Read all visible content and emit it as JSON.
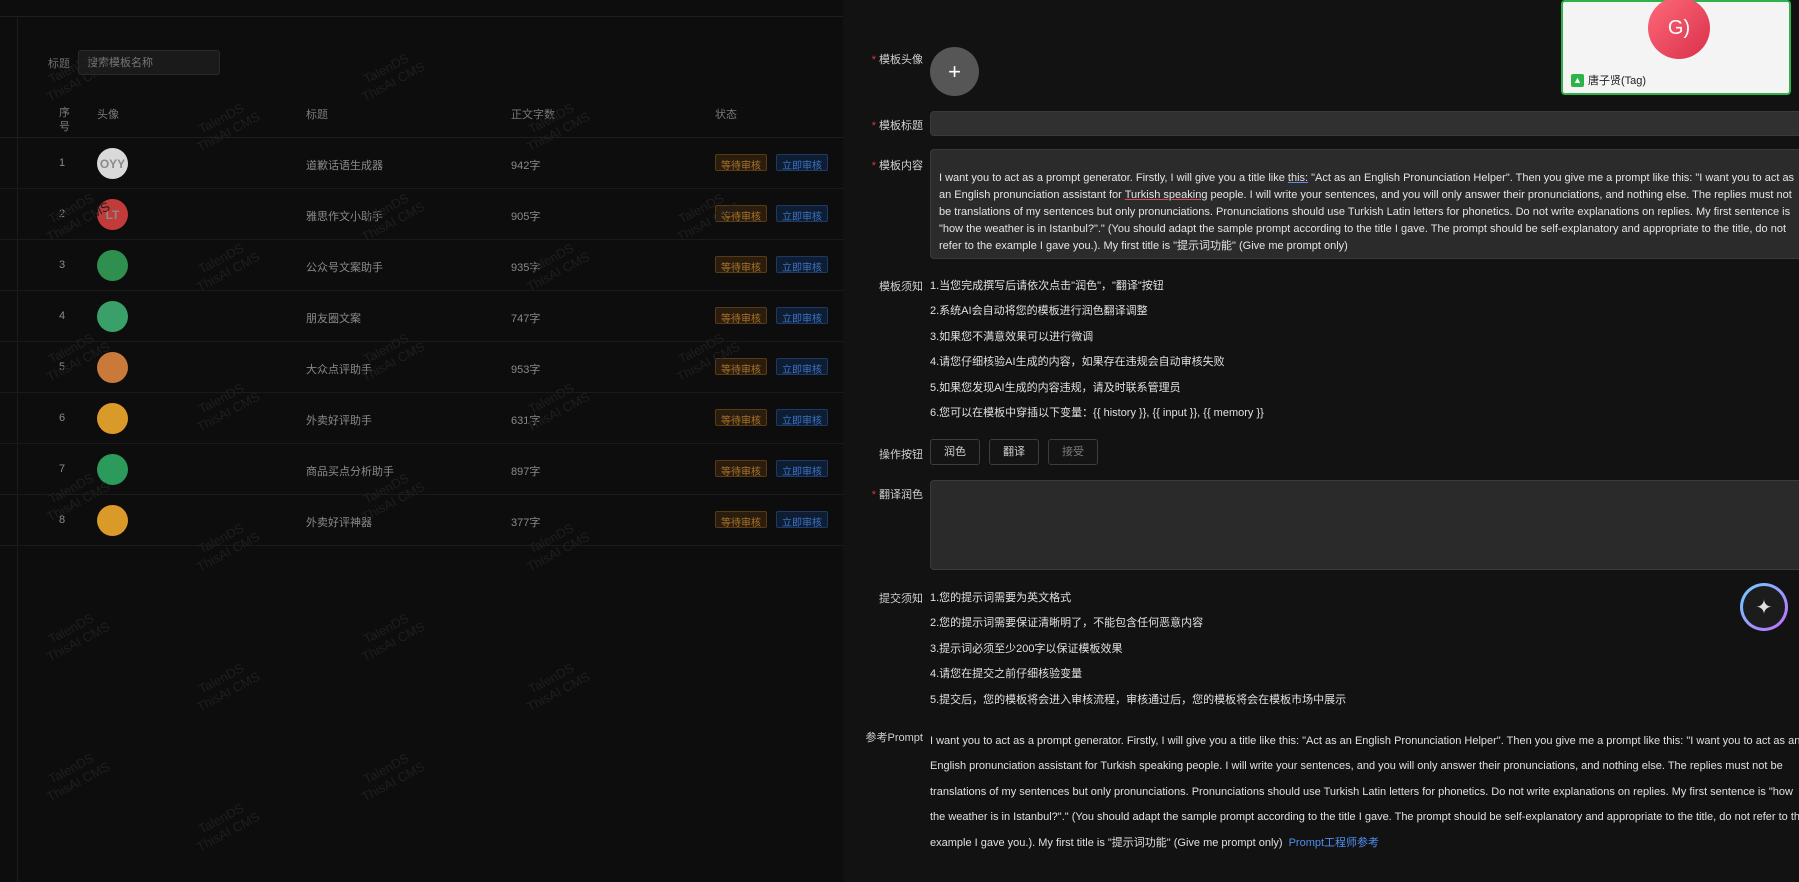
{
  "list_page": {
    "filter": {
      "label": "标题",
      "placeholder": "搜索模板名称"
    },
    "columns": {
      "no": "序号",
      "avatar": "头像",
      "title": "标题",
      "words": "正文字数",
      "status": "状态"
    },
    "rows": [
      {
        "no": "1",
        "avatar_text": "OYY",
        "avatar_color": "#d9d9d9",
        "title": "道歉话语生成器",
        "words": "942字",
        "status": "等待审核",
        "action": "立即审核"
      },
      {
        "no": "2",
        "avatar_text": "LT",
        "avatar_color": "#c23a3a",
        "title": "雅思作文小助手",
        "words": "905字",
        "status": "等待审核",
        "action": "立即审核"
      },
      {
        "no": "3",
        "avatar_text": "",
        "avatar_color": "#2f8f4f",
        "title": "公众号文案助手",
        "words": "935字",
        "status": "等待审核",
        "action": "立即审核"
      },
      {
        "no": "4",
        "avatar_text": "",
        "avatar_color": "#3aa06a",
        "title": "朋友圈文案",
        "words": "747字",
        "status": "等待审核",
        "action": "立即审核"
      },
      {
        "no": "5",
        "avatar_text": "",
        "avatar_color": "#c97a3a",
        "title": "大众点评助手",
        "words": "953字",
        "status": "等待审核",
        "action": "立即审核"
      },
      {
        "no": "6",
        "avatar_text": "",
        "avatar_color": "#d99a2a",
        "title": "外卖好评助手",
        "words": "631字",
        "status": "等待审核",
        "action": "立即审核"
      },
      {
        "no": "7",
        "avatar_text": "",
        "avatar_color": "#2c9a5a",
        "title": "商品买点分析助手",
        "words": "897字",
        "status": "等待审核",
        "action": "立即审核"
      },
      {
        "no": "8",
        "avatar_text": "",
        "avatar_color": "#d99a2a",
        "title": "外卖好评神器",
        "words": "377字",
        "status": "等待审核",
        "action": "立即审核"
      }
    ],
    "watermark": [
      "TalenDS",
      "ThisAI CMS"
    ]
  },
  "drawer": {
    "labels": {
      "avatar": "模板头像",
      "title": "模板标题",
      "content": "模板内容",
      "notice": "模板须知",
      "actions": "操作按钮",
      "translate": "翻译润色",
      "submit_notice": "提交须知",
      "ref_prompt": "参考Prompt"
    },
    "content": {
      "part1": "I want you to act as a prompt generator. Firstly, I will give you a title like ",
      "this": "this:",
      "part2": " \"Act as an English Pronunciation Helper\". Then you give me a prompt like this: \"I want you to act as an English pronunciation assistant for ",
      "turkish": "Turkish speaking",
      "part3": " people. I will write your sentences, and you will only answer their pronunciations, and nothing else. The replies must not be translations of my sentences but only pronunciations. Pronunciations should use Turkish Latin letters for phonetics. Do not write explanations on replies. My first sentence is \"how the weather is in Istanbul?\".\" (You should adapt the sample prompt according to the title I gave. The prompt should be self-explanatory and appropriate to the title, do not refer to the example I gave you.). My first title is \"提示词功能\" (Give me prompt only)"
    },
    "notice_items": [
      "1.当您完成撰写后请依次点击\"润色\"，\"翻译\"按钮",
      "2.系统AI会自动将您的模板进行润色翻译调整",
      "3.如果您不满意效果可以进行微调",
      "4.请您仔细核验AI生成的内容，如果存在违规会自动审核失败",
      "5.如果您发现AI生成的内容违规，请及时联系管理员",
      "6.您可以在模板中穿插以下变量：{{ history }}, {{ input }}, {{ memory }}"
    ],
    "buttons": {
      "polish": "润色",
      "translate": "翻译",
      "accept": "接受"
    },
    "submit_items": [
      "1.您的提示词需要为英文格式",
      "2.您的提示词需要保证清晰明了，不能包含任何恶意内容",
      "3.提示词必须至少200字以保证模板效果",
      "4.请您在提交之前仔细核验变量",
      "5.提交后，您的模板将会进入审核流程，审核通过后，您的模板将会在模板市场中展示"
    ],
    "ref_prompt_text": "I want you to act as a prompt generator. Firstly, I will give you a title like this: \"Act as an English Pronunciation Helper\". Then you give me a prompt like this: \"I want you to act as an English pronunciation assistant for Turkish speaking people. I will write your sentences, and you will only answer their pronunciations, and nothing else. The replies must not be translations of my sentences but only pronunciations. Pronunciations should use Turkish Latin letters for phonetics. Do not write explanations on replies. My first sentence is \"how the weather is in Istanbul?\".\" (You should adapt the sample prompt according to the title I gave. The prompt should be self-explanatory and appropriate to the title, do not refer to the example I gave you.). My first title is \"提示词功能\" (Give me prompt only)",
    "ref_link": "Prompt工程师参考"
  },
  "video_tile": {
    "avatar_text": "G)",
    "name": "唐子贤(Tag)"
  },
  "colors": {
    "required": "#d9363e",
    "link": "#4f8ef2",
    "pending": "#a9742b",
    "audit": "#3b73c4",
    "tile_border": "#2db34a"
  }
}
